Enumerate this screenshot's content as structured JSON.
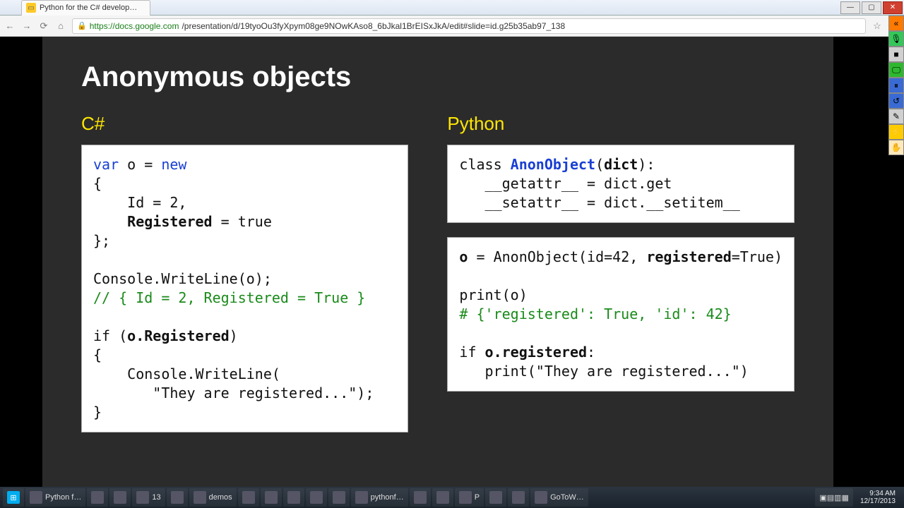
{
  "window": {
    "tab_title": "Python for the C# develop…",
    "min": "—",
    "max": "▢",
    "close": "✕"
  },
  "addr": {
    "back": "←",
    "fwd": "→",
    "reload": "⟳",
    "home": "⌂",
    "lock": "🔒",
    "domain": "https://docs.google.com",
    "path": "/presentation/d/19tyoOu3fyXpym08ge9NOwKAso8_6bJkal1BrEISxJkA/edit#slide=id.g25b35ab97_138",
    "star": "☆",
    "menu": "»"
  },
  "slide": {
    "title": "Anonymous objects",
    "left_lang": "C#",
    "right_lang": "Python",
    "csharp": {
      "l1a": "var",
      "l1b": " o = ",
      "l1c": "new",
      "l2": "{",
      "l3a": "    Id = 2,",
      "l4a": "    ",
      "l4b": "Registered",
      "l4c": " = true",
      "l5": "};",
      "l6": "",
      "l7": "Console.WriteLine(o);",
      "l8": "// { Id = 2, Registered = True }",
      "l9": "",
      "l10a": "if (",
      "l10b": "o.Registered",
      "l10c": ")",
      "l11": "{",
      "l12": "    Console.WriteLine(",
      "l13": "       \"They are registered...\");",
      "l14": "}"
    },
    "py1": {
      "l1a": "class ",
      "l1b": "AnonObject",
      "l1c": "(",
      "l1d": "dict",
      "l1e": "):",
      "l2": "   __getattr__ = dict.get",
      "l3": "   __setattr__ = dict.__setitem__"
    },
    "py2": {
      "l1a": "o",
      "l1b": " = AnonObject(id=42, ",
      "l1c": "registered",
      "l1d": "=True)",
      "l2": "",
      "l3": "print(o)",
      "l4": "# {'registered': True, 'id': 42}",
      "l5": "",
      "l6a": "if ",
      "l6b": "o.registered",
      "l6c": ":",
      "l7": "   print(\"They are registered...\")"
    }
  },
  "sidetool": {
    "items": [
      {
        "bg": "#ff7a00",
        "glyph": "«"
      },
      {
        "bg": "#34c759",
        "glyph": "🎙"
      },
      {
        "bg": "#d0d0d0",
        "glyph": "■"
      },
      {
        "bg": "#2eb82e",
        "glyph": "🖵"
      },
      {
        "bg": "#3a6ad4",
        "glyph": "⏸"
      },
      {
        "bg": "#3a6ad4",
        "glyph": "↺"
      },
      {
        "bg": "#d0d0d0",
        "glyph": "✎"
      },
      {
        "bg": "#ffcc00",
        "glyph": "⚡"
      },
      {
        "bg": "#ffe9bb",
        "glyph": "✋"
      }
    ]
  },
  "taskbar": {
    "start": "⊞",
    "items": [
      "Python f…",
      "",
      "",
      "13",
      "",
      "demos",
      "",
      "",
      "",
      "",
      "",
      "pythonf…",
      "",
      "",
      "P",
      "",
      "",
      "GoToW…"
    ],
    "tray": "▣▤▥▦",
    "time": "9:34 AM",
    "date": "12/17/2013"
  }
}
